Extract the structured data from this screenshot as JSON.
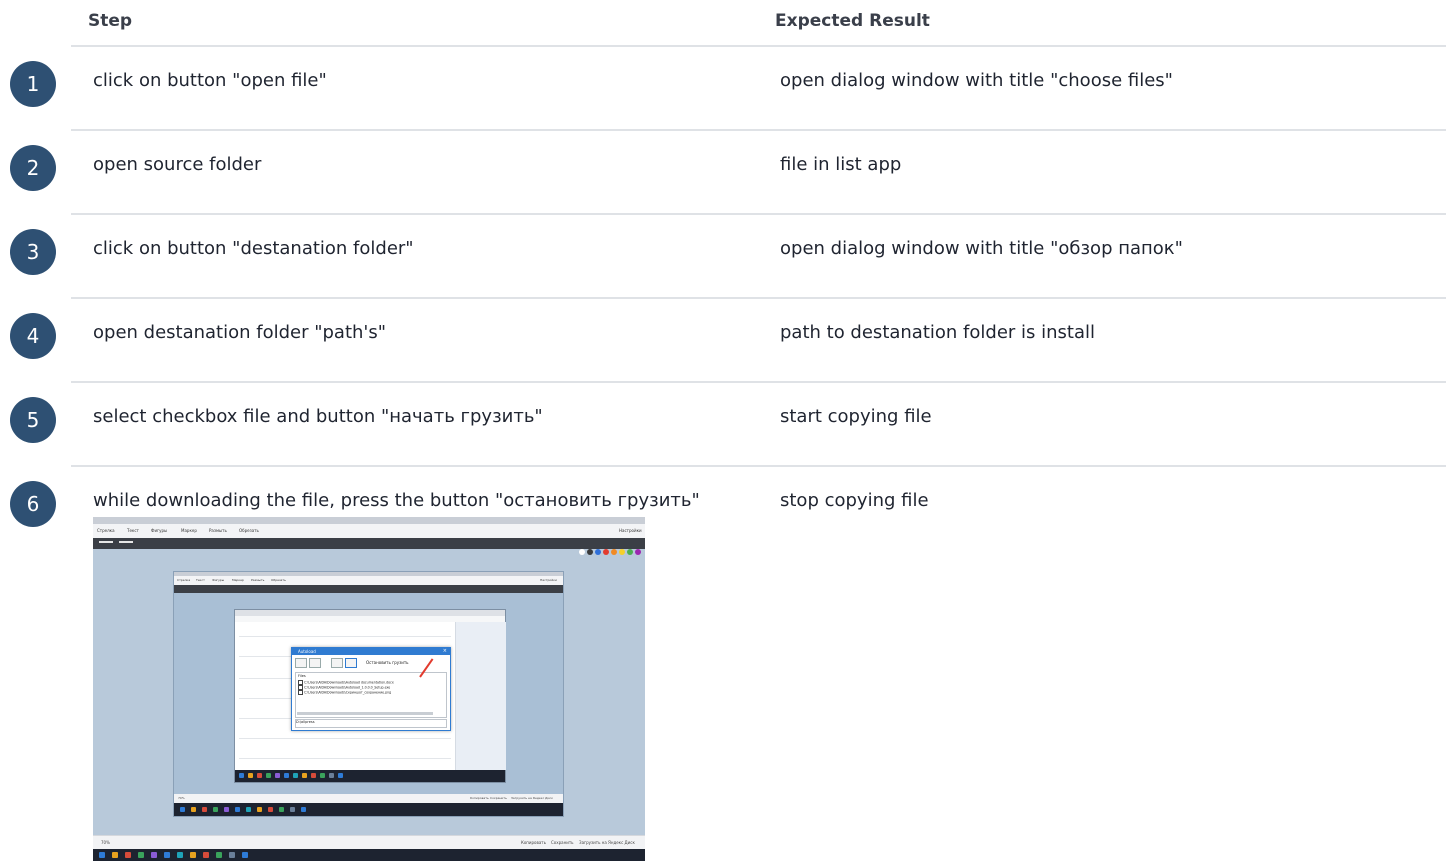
{
  "table": {
    "headers": {
      "step": "Step",
      "expected": "Expected Result"
    },
    "rows": [
      {
        "number": "1",
        "step": "click on button \"open file\"",
        "expected": "open dialog window with title \"choose files\""
      },
      {
        "number": "2",
        "step": "open source folder",
        "expected": "file in list app"
      },
      {
        "number": "3",
        "step": "click on button \"destanation folder\"",
        "expected": "open dialog window with title \"обзор папок\""
      },
      {
        "number": "4",
        "step": "open destanation folder \"path's\"",
        "expected": "path to destanation folder is install"
      },
      {
        "number": "5",
        "step": "select checkbox file and button \"начать грузить\"",
        "expected": "start copying file"
      },
      {
        "number": "6",
        "step": "while downloading the file, press the button \"остановить грузить\"",
        "expected": "stop copying file"
      }
    ]
  },
  "screenshot": {
    "toolbar_items": [
      "Стрелка",
      "Текст",
      "Фигуры",
      "Маркер",
      "Размыть",
      "Обрезать"
    ],
    "settings_label": "Настройки",
    "zoom_level": "70%",
    "bottom_actions": [
      "Копировать",
      "Сохранить",
      "Загрузить на Яндекс Диск"
    ],
    "color_dots": [
      "#ffffff",
      "#3a3a3a",
      "#2f6fd8",
      "#e23b2e",
      "#f08a24",
      "#f5d02a",
      "#4caf50",
      "#9c27b0"
    ],
    "dialog": {
      "title": "Autoload",
      "stop_label": "Остановить грузить",
      "list_header": "Files",
      "files": [
        "C:\\Users\\AIDA\\Downloads\\Autoload documentation.docx",
        "C:\\Users\\AIDA\\Downloads\\Autoload_1.0.0.0_Setup.exe",
        "C:\\Users\\AIDA\\Downloads\\Скриншот_сохранение.png"
      ],
      "path_value": "D:\\allpress"
    },
    "taskbar_colors": [
      "#2e7bd6",
      "#e8a21f",
      "#d64b3a",
      "#3aa35c",
      "#8a5cd6",
      "#2e7bd6",
      "#1fa3b8",
      "#e8a21f",
      "#d64b3a",
      "#3aa35c",
      "#6a7f99",
      "#2e7bd6"
    ]
  }
}
